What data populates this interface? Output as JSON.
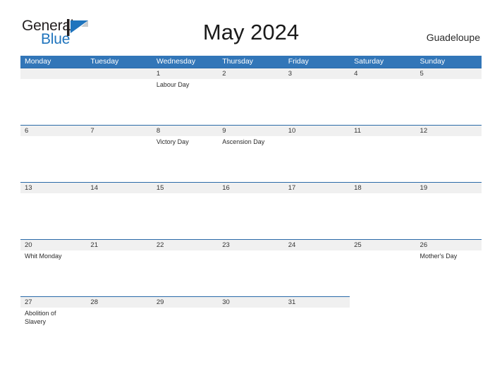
{
  "brand": {
    "word1": "General",
    "word2": "Blue",
    "mark": "flag-triangle-icon"
  },
  "header": {
    "title": "May 2024",
    "location": "Guadeloupe"
  },
  "calendar": {
    "weekday_headers": [
      "Monday",
      "Tuesday",
      "Wednesday",
      "Thursday",
      "Friday",
      "Saturday",
      "Sunday"
    ],
    "colors": {
      "header_blue": "#3276b8",
      "separator_blue": "#2a6aa8",
      "band_gray": "#f0f0f0",
      "brand_blue": "#1f74bd"
    },
    "weeks": [
      {
        "days": [
          {
            "date": "",
            "events": []
          },
          {
            "date": "",
            "events": []
          },
          {
            "date": "1",
            "events": [
              "Labour Day"
            ]
          },
          {
            "date": "2",
            "events": []
          },
          {
            "date": "3",
            "events": []
          },
          {
            "date": "4",
            "events": []
          },
          {
            "date": "5",
            "events": []
          }
        ]
      },
      {
        "days": [
          {
            "date": "6",
            "events": []
          },
          {
            "date": "7",
            "events": []
          },
          {
            "date": "8",
            "events": [
              "Victory Day"
            ]
          },
          {
            "date": "9",
            "events": [
              "Ascension Day"
            ]
          },
          {
            "date": "10",
            "events": []
          },
          {
            "date": "11",
            "events": []
          },
          {
            "date": "12",
            "events": []
          }
        ]
      },
      {
        "days": [
          {
            "date": "13",
            "events": []
          },
          {
            "date": "14",
            "events": []
          },
          {
            "date": "15",
            "events": []
          },
          {
            "date": "16",
            "events": []
          },
          {
            "date": "17",
            "events": []
          },
          {
            "date": "18",
            "events": []
          },
          {
            "date": "19",
            "events": []
          }
        ]
      },
      {
        "days": [
          {
            "date": "20",
            "events": [
              "Whit Monday"
            ]
          },
          {
            "date": "21",
            "events": []
          },
          {
            "date": "22",
            "events": []
          },
          {
            "date": "23",
            "events": []
          },
          {
            "date": "24",
            "events": []
          },
          {
            "date": "25",
            "events": []
          },
          {
            "date": "26",
            "events": [
              "Mother's Day"
            ]
          }
        ]
      },
      {
        "days": [
          {
            "date": "27",
            "events": [
              "Abolition of Slavery"
            ]
          },
          {
            "date": "28",
            "events": []
          },
          {
            "date": "29",
            "events": []
          },
          {
            "date": "30",
            "events": []
          },
          {
            "date": "31",
            "events": []
          },
          {
            "date": "",
            "events": []
          },
          {
            "date": "",
            "events": []
          }
        ]
      }
    ]
  }
}
